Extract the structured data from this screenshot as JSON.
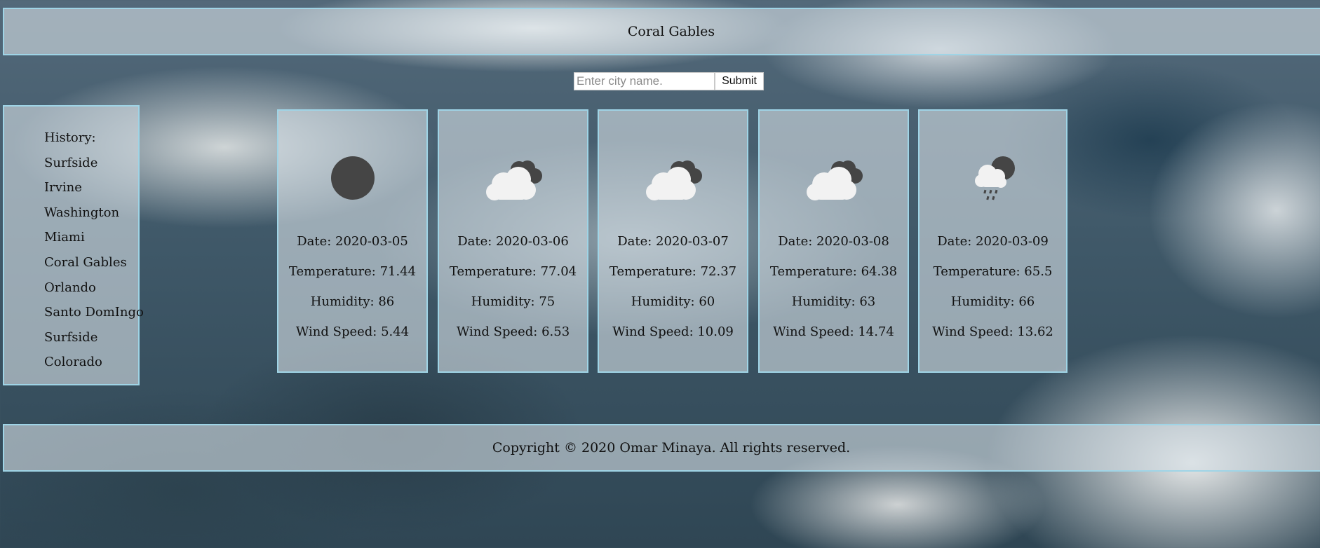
{
  "header": {
    "city": "Coral Gables"
  },
  "search": {
    "placeholder": "Enter city name.",
    "submit_label": "Submit"
  },
  "history": {
    "title": "History:",
    "items": [
      "Surfside",
      "Irvine",
      "Washington",
      "Miami",
      "Coral Gables",
      "Orlando",
      "Santo DomIngo",
      "Surfside",
      "Colorado"
    ]
  },
  "forecast": [
    {
      "icon": "clear-moon-icon",
      "date": "Date: 2020-03-05",
      "temperature": "Temperature: 71.44",
      "humidity": "Humidity: 86",
      "wind": "Wind Speed: 5.44"
    },
    {
      "icon": "broken-clouds-icon",
      "date": "Date: 2020-03-06",
      "temperature": "Temperature: 77.04",
      "humidity": "Humidity: 75",
      "wind": "Wind Speed: 6.53"
    },
    {
      "icon": "broken-clouds-icon",
      "date": "Date: 2020-03-07",
      "temperature": "Temperature: 72.37",
      "humidity": "Humidity: 60",
      "wind": "Wind Speed: 10.09"
    },
    {
      "icon": "broken-clouds-icon",
      "date": "Date: 2020-03-08",
      "temperature": "Temperature: 64.38",
      "humidity": "Humidity: 63",
      "wind": "Wind Speed: 14.74"
    },
    {
      "icon": "rain-icon",
      "date": "Date: 2020-03-09",
      "temperature": "Temperature: 65.5",
      "humidity": "Humidity: 66",
      "wind": "Wind Speed: 13.62"
    }
  ],
  "footer": {
    "copyright": "Copyright © 2020 Omar Minaya. All rights reserved."
  },
  "colors": {
    "panel_border": "#9fd4e6",
    "icon_dark": "#454545",
    "icon_light": "#f2f2f2"
  }
}
